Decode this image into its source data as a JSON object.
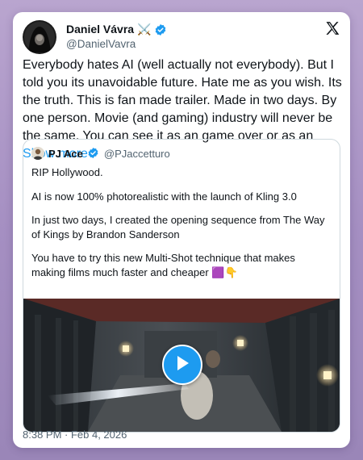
{
  "author": {
    "name": "Daniel Vávra ⚔️",
    "handle": "@DanielVavra"
  },
  "tweet": {
    "text": "Everybody hates AI (well actually not everybody). But I told you its unavoidable future. Hate me as you wish. Its the truth. This is fan made trailer. Made in two days. By one person. Movie (and gaming) industry will never be the same. You can see it as an game over or as an",
    "show_more": "Show more",
    "timestamp": "8:38 PM · Feb 4, 2026"
  },
  "quoted": {
    "name": "PJ Ace",
    "handle": "@PJaccetturo",
    "lines": [
      "RIP Hollywood.",
      "AI is now 100% photorealistic with the launch of Kling 3.0",
      "In just two days, I created the opening sequence from The Way of Kings by Brandon Sanderson",
      "You have to try this new Multi-Shot technique that makes making films much faster and cheaper 🟪👇"
    ]
  },
  "icons": {
    "verified": "verified-badge-icon",
    "x_logo": "x-logo-icon",
    "play": "play-icon"
  },
  "colors": {
    "accent": "#1d9bf0",
    "text": "#0f1419",
    "muted": "#536471",
    "border": "#cfd9de"
  }
}
